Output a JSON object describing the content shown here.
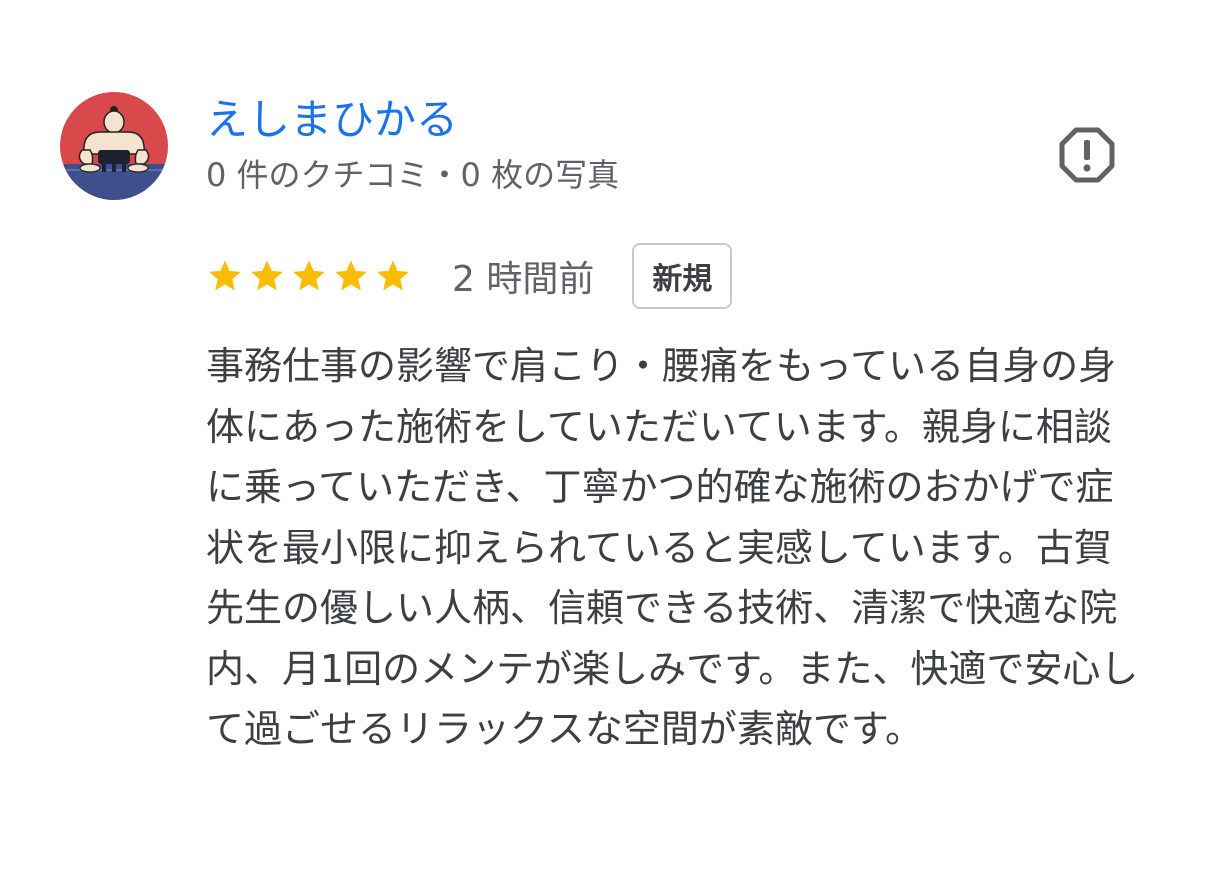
{
  "reviewer": {
    "name": "えしまひかる",
    "meta": "0 件のクチコミ・0 枚の写真",
    "avatar_icon": "sumo-wrestler-avatar"
  },
  "report": {
    "icon": "report-flag-icon"
  },
  "review": {
    "rating": 5,
    "rating_max": 5,
    "time": "2 時間前",
    "badge": "新規",
    "text": "事務仕事の影響で肩こり・腰痛をもっている自身の身体にあった施術をしていただいています。親身に相談に乗っていただき、丁寧かつ的確な施術のおかげで症状を最小限に抑えられていると実感しています。古賀先生の優しい人柄、信頼できる技術、清潔で快適な院内、月1回のメンテが楽しみです。また、快適で安心して過ごせるリラックスな空間が素敵です。"
  },
  "colors": {
    "name": "#1a73e8",
    "star": "#fbbc04",
    "text": "#3c4043",
    "meta": "#5f6368",
    "avatar_red": "#d9484a",
    "avatar_blue": "#3d4f8c"
  }
}
